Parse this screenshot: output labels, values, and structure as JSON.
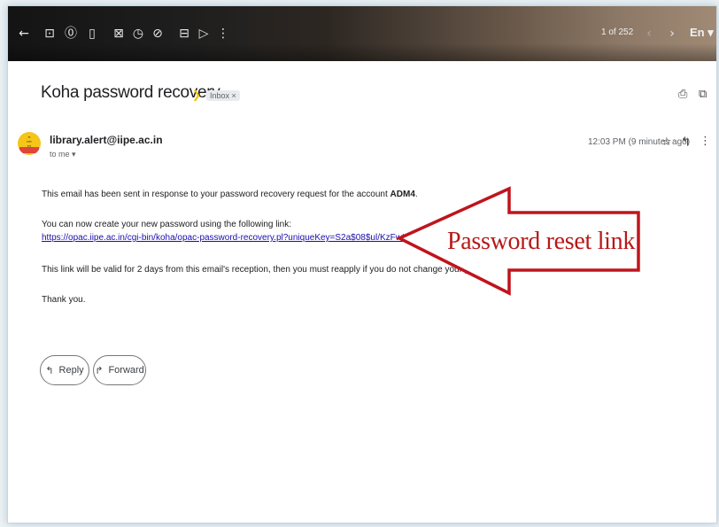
{
  "toolbar": {
    "back_icon": "arrow-left-icon",
    "icons": [
      "archive-icon",
      "report-spam-icon",
      "delete-icon",
      "mark-unread-icon",
      "snooze-icon",
      "add-task-icon",
      "move-to-icon",
      "label-icon",
      "more-vert-icon"
    ],
    "count": "1 of 252",
    "prev_icon": "chevron-left-icon",
    "next_icon": "chevron-right-icon",
    "language": "En ▾"
  },
  "email": {
    "subject": "Koha password recovery",
    "label_chip": "Inbox ×",
    "sender": "library.alert@iipe.ac.in",
    "recipient": "to me ▾",
    "timestamp": "12:03 PM (9 minutes ago)",
    "body": {
      "line1_prefix": "This email has been sent in response to your password recovery request for the account ",
      "account": "ADM4",
      "line1_suffix": ".",
      "line2": "You can now create your new password using the following link:",
      "link": "https://opac.iipe.ac.in/cgi-bin/koha/opac-password-recovery.pl?uniqueKey=S2a$08$ul/KzFwHL76P1a.z6Rbwyu",
      "line3": "This link will be valid for 2 days from this email's reception, then you must reapply if you do not change your password.",
      "line4": "Thank you."
    },
    "reply_label": "Reply",
    "forward_label": "Forward"
  },
  "annotation": {
    "text": "Password reset link",
    "color": "#c0141c"
  }
}
